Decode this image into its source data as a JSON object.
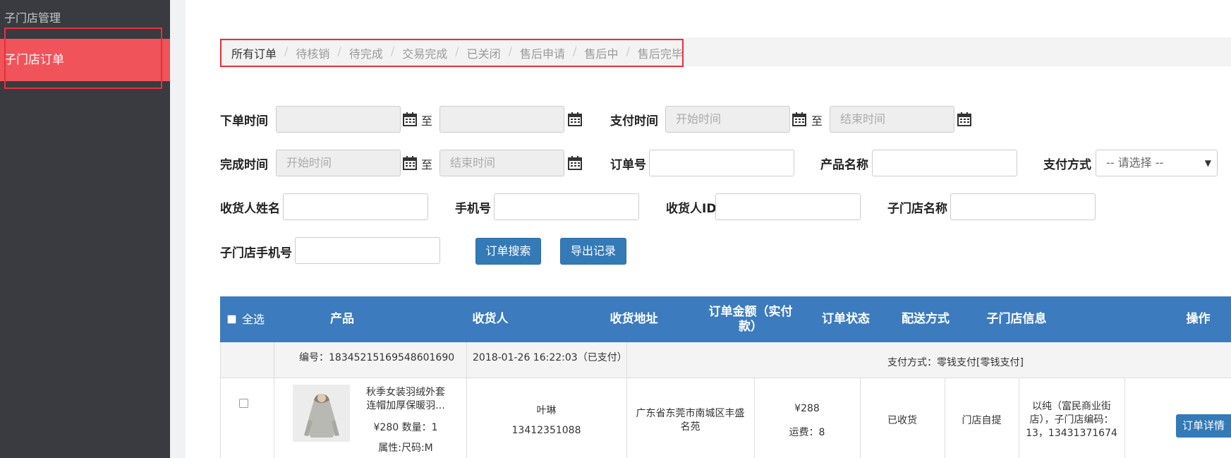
{
  "sidebar": {
    "title": "子门店管理",
    "items": [
      {
        "label": "子门店订单"
      }
    ]
  },
  "tabs": [
    {
      "label": "所有订单",
      "active": true
    },
    {
      "label": "待核销"
    },
    {
      "label": "待完成"
    },
    {
      "label": "交易完成"
    },
    {
      "label": "已关闭"
    },
    {
      "label": "售后申请"
    },
    {
      "label": "售后中"
    },
    {
      "label": "售后完毕"
    }
  ],
  "tab_separator": "/",
  "filters": {
    "order_time_label": "下单时间",
    "pay_time_label": "支付时间",
    "finish_time_label": "完成时间",
    "to_label": "至",
    "start_placeholder": "开始时间",
    "end_placeholder": "结束时间",
    "order_no_label": "订单号",
    "product_name_label": "产品名称",
    "pay_method_label": "支付方式",
    "pay_method_selected": "-- 请选择 --",
    "receiver_name_label": "收货人姓名",
    "phone_label": "手机号",
    "receiver_id_label": "收货人ID",
    "store_name_label": "子门店名称",
    "store_phone_label": "子门店手机号",
    "search_button": "订单搜索",
    "export_button": "导出记录"
  },
  "table": {
    "headers": {
      "select_all": "全选",
      "product": "产品",
      "receiver": "收货人",
      "address": "收货地址",
      "amount_line1": "订单金额（实付",
      "amount_line2": "款）",
      "status": "订单状态",
      "delivery": "配送方式",
      "store_info": "子门店信息",
      "action": "操作"
    },
    "orders": [
      {
        "order_no": "编号：18345215169548601690",
        "datetime": "2018-01-26 16:22:03（已支付）",
        "pay_method": "支付方式：零钱支付[零钱支付]",
        "product_name_line1": "秋季女装羽绒外套",
        "product_name_line2": "连帽加厚保暖羽...",
        "price_qty": "¥280 数量：1",
        "attr": "属性:尺码:M",
        "receiver_name": "叶琳",
        "receiver_phone": "13412351088",
        "address_line1": "广东省东莞市南城区丰盛",
        "address_line2": "名苑",
        "amount": "¥288",
        "shipping": "运费：8",
        "status": "已收货",
        "delivery": "门店自提",
        "store_line1": "以纯（富民商业街",
        "store_line2": "店），子门店编码：",
        "store_line3": "13，13431371674",
        "detail_button": "订单详情"
      }
    ]
  },
  "colors": {
    "sidebar_bg": "#393b40",
    "sidebar_active": "#f0535a",
    "highlight_box": "#e8303a",
    "table_header": "#3c7bbd",
    "button": "#337ab7"
  }
}
